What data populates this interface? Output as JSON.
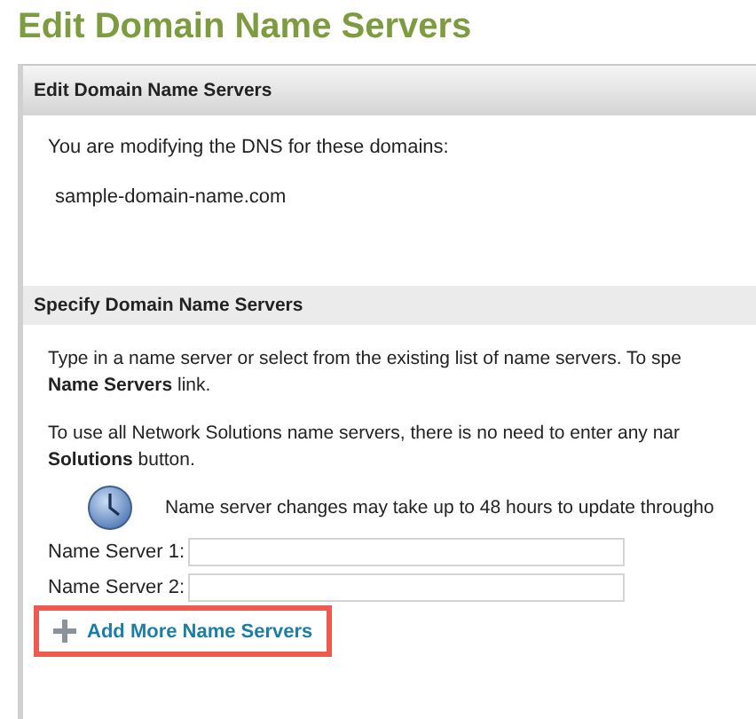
{
  "page_title": "Edit Domain Name Servers",
  "panel": {
    "title": "Edit Domain Name Servers",
    "intro": "You are modifying the DNS for these domains:",
    "domain": "sample-domain-name.com"
  },
  "section": {
    "title": "Specify Domain Name Servers",
    "paragraphs": [
      [
        "Type in a name server or select from the existing list of name servers. To spe",
        "**Name Servers** link."
      ],
      [
        "To use all Network Solutions name servers, there is no need to enter any nar",
        "**Solutions** button."
      ]
    ],
    "notice": "Name server changes may take up to 48 hours to update througho",
    "fields": [
      {
        "label": "Name Server 1:"
      },
      {
        "label": "Name Server 2:"
      }
    ],
    "add_link": {
      "label": "Add More Name Servers",
      "highlighted": true
    }
  }
}
